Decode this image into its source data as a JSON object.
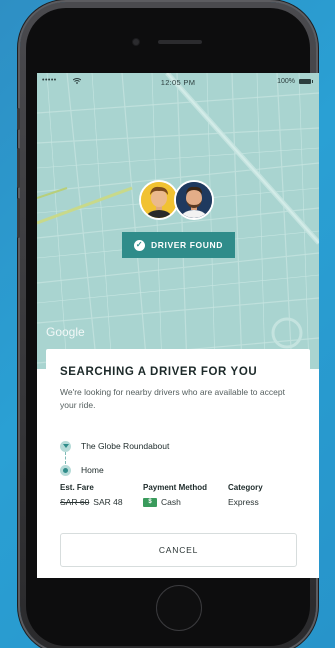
{
  "status_bar": {
    "signal": "•••••",
    "time": "12:05 PM",
    "battery": "100%"
  },
  "map": {
    "provider": "Google",
    "badge": {
      "label": "DRIVER FOUND",
      "color": "#2f8c8a",
      "icon": "check-circle-icon"
    },
    "colors": {
      "water": "#a9d4d0",
      "route": "#c8d98a"
    }
  },
  "sheet": {
    "title": "SEARCHING A DRIVER FOR YOU",
    "subtitle": "We're looking for nearby drivers who are available to accept your ride.",
    "route": {
      "pickup": "The Globe Roundabout",
      "dropoff": "Home"
    },
    "fare": {
      "label": "Est. Fare",
      "old": "SAR 60",
      "new": "SAR 48"
    },
    "payment": {
      "label": "Payment Method",
      "value": "Cash",
      "icon": "cash-icon"
    },
    "category": {
      "label": "Category",
      "value": "Express"
    },
    "cancel_label": "CANCEL"
  }
}
